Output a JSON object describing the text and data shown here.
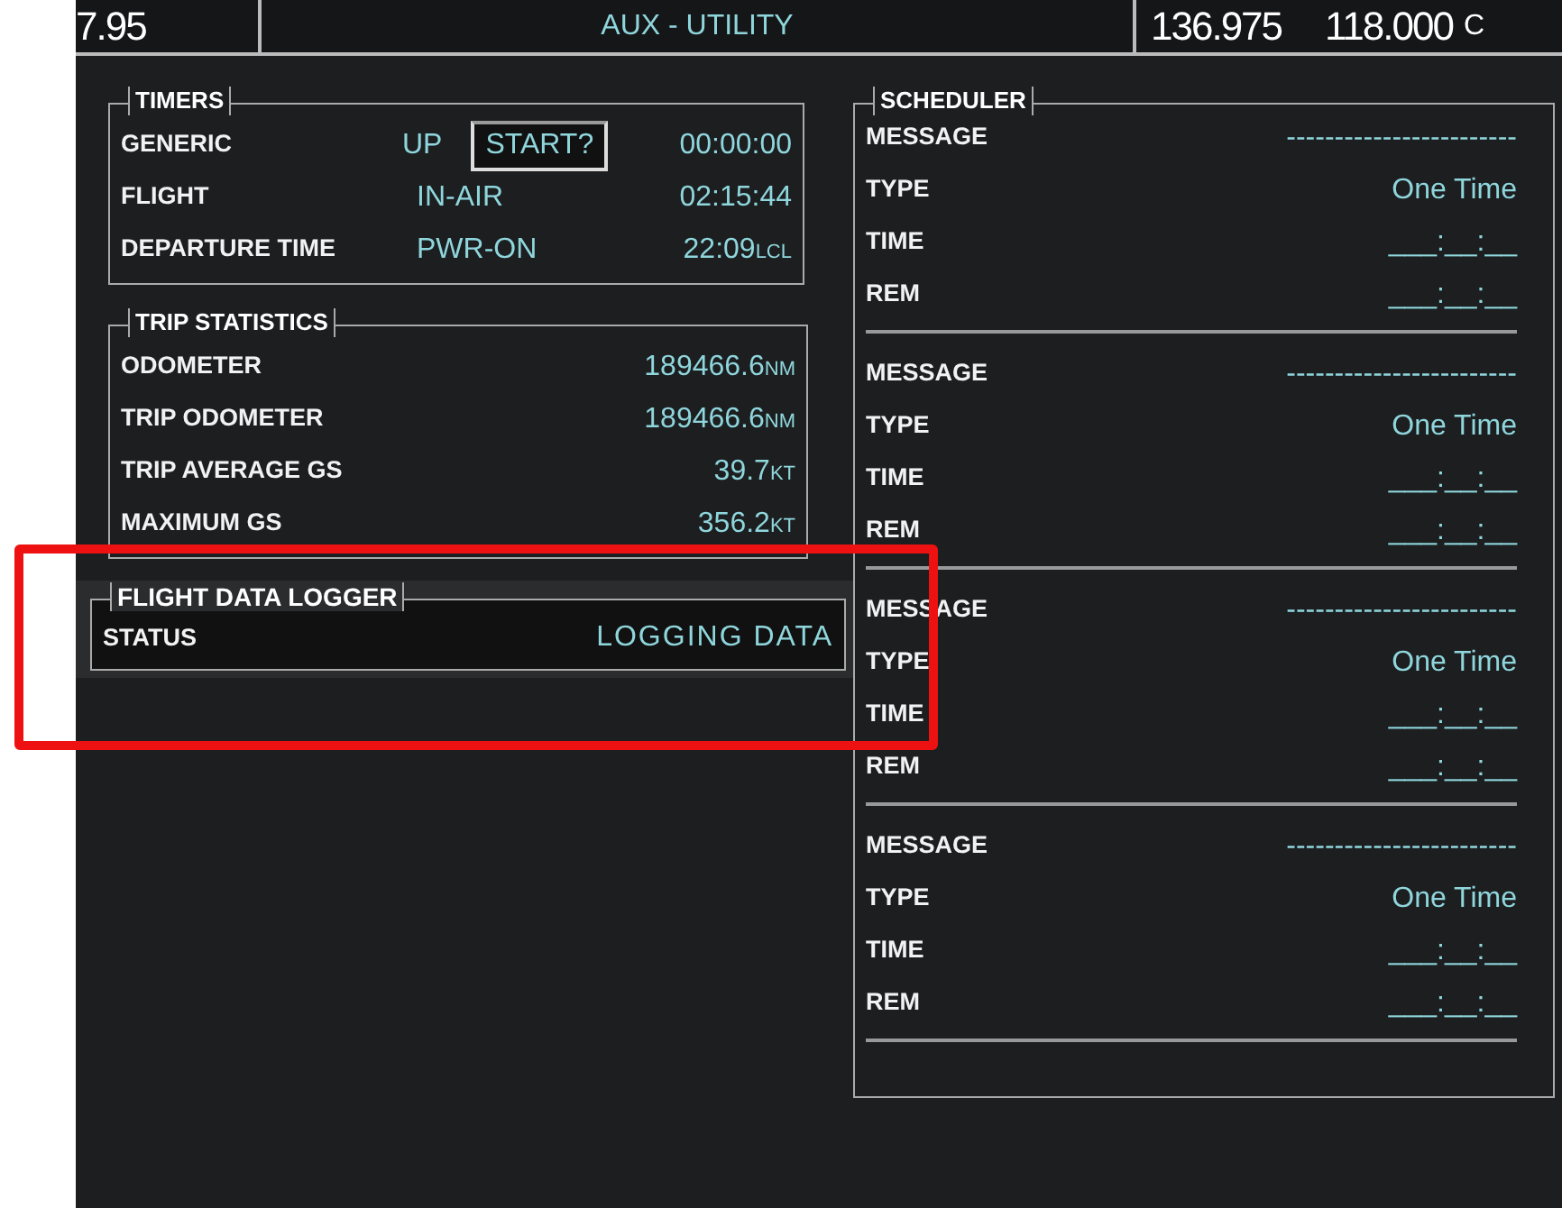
{
  "top_bar": {
    "left_frequency": "7.95",
    "title": "AUX - UTILITY",
    "standby_frequency": "136.975",
    "active_frequency": "118.000",
    "cut_label": "C"
  },
  "timers": {
    "title": "TIMERS",
    "rows": [
      {
        "label": "GENERIC",
        "mode": "UP",
        "button": "START?",
        "value": "00:00:00"
      },
      {
        "label": "FLIGHT",
        "mode": "IN-AIR",
        "value": "02:15:44"
      },
      {
        "label": "DEPARTURE TIME",
        "mode": "PWR-ON",
        "value": "22:09",
        "unit": "LCL"
      }
    ]
  },
  "trip_statistics": {
    "title": "TRIP STATISTICS",
    "rows": [
      {
        "label": "ODOMETER",
        "value": "189466.6",
        "unit": "NM"
      },
      {
        "label": "TRIP ODOMETER",
        "value": "189466.6",
        "unit": "NM"
      },
      {
        "label": "TRIP AVERAGE GS",
        "value": "39.7",
        "unit": "KT"
      },
      {
        "label": "MAXIMUM GS",
        "value": "356.2",
        "unit": "KT"
      }
    ]
  },
  "flight_data_logger": {
    "title": "FLIGHT DATA LOGGER",
    "highlighted": true,
    "rows": [
      {
        "label": "STATUS",
        "value": "LOGGING DATA"
      }
    ]
  },
  "scheduler": {
    "title": "SCHEDULER",
    "entries": [
      {
        "rows": [
          {
            "label": "MESSAGE",
            "value": "------------------------"
          },
          {
            "label": "TYPE",
            "value": "One Time"
          },
          {
            "label": "TIME",
            "value": "___:__:__"
          },
          {
            "label": "REM",
            "value": "___:__:__"
          }
        ]
      },
      {
        "rows": [
          {
            "label": "MESSAGE",
            "value": "------------------------"
          },
          {
            "label": "TYPE",
            "value": "One Time"
          },
          {
            "label": "TIME",
            "value": "___:__:__"
          },
          {
            "label": "REM",
            "value": "___:__:__"
          }
        ]
      },
      {
        "rows": [
          {
            "label": "MESSAGE",
            "value": "------------------------"
          },
          {
            "label": "TYPE",
            "value": "One Time"
          },
          {
            "label": "TIME",
            "value": "___:__:__"
          },
          {
            "label": "REM",
            "value": "___:__:__"
          }
        ]
      },
      {
        "rows": [
          {
            "label": "MESSAGE",
            "value": "------------------------"
          },
          {
            "label": "TYPE",
            "value": "One Time"
          },
          {
            "label": "TIME",
            "value": "___:__:__"
          },
          {
            "label": "REM",
            "value": "___:__:__"
          }
        ]
      }
    ]
  }
}
